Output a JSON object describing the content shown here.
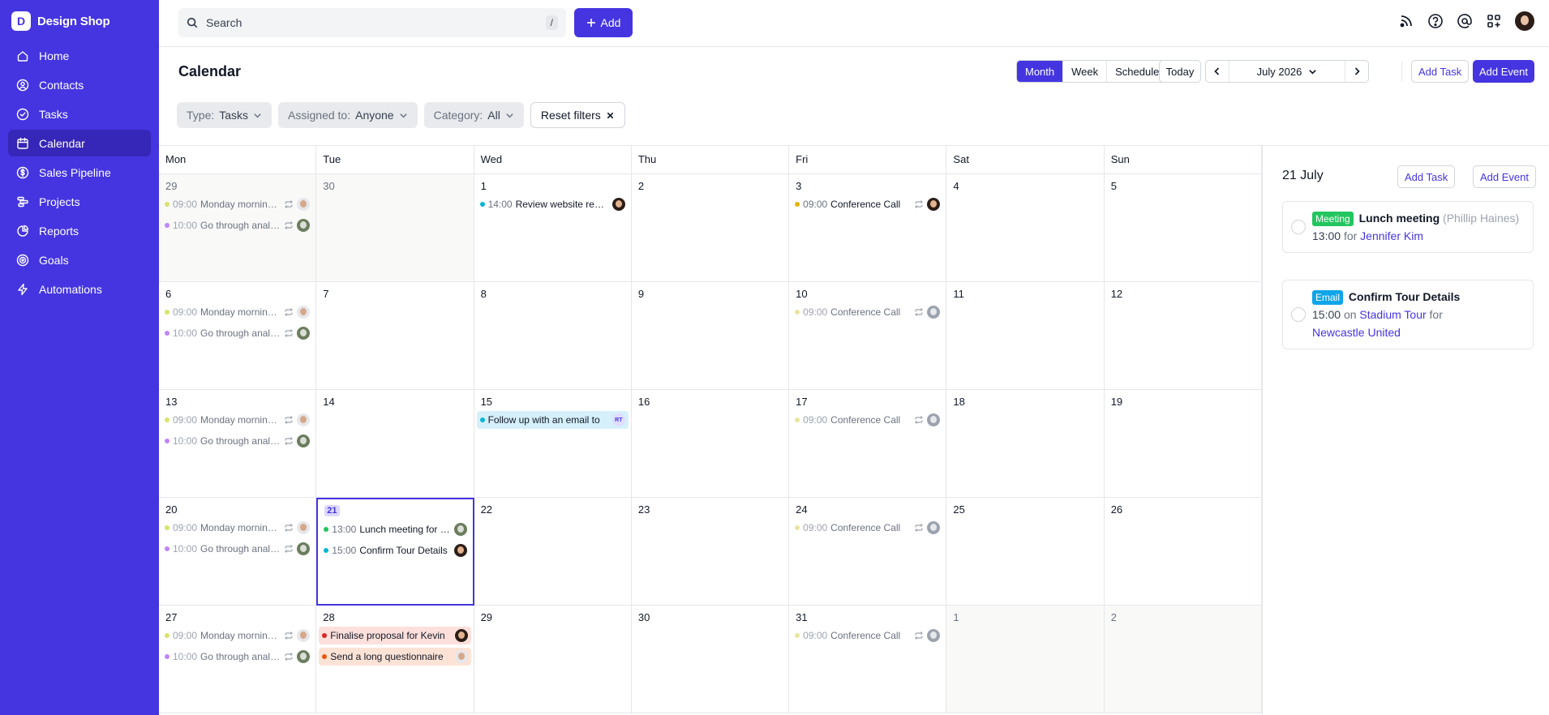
{
  "brand": {
    "logo_letter": "D",
    "name": "Design Shop"
  },
  "sidebar": {
    "items": [
      {
        "label": "Home",
        "icon": "home-icon"
      },
      {
        "label": "Contacts",
        "icon": "contacts-icon"
      },
      {
        "label": "Tasks",
        "icon": "tasks-icon"
      },
      {
        "label": "Calendar",
        "icon": "calendar-icon",
        "active": true
      },
      {
        "label": "Sales Pipeline",
        "icon": "dollar-icon"
      },
      {
        "label": "Projects",
        "icon": "projects-icon"
      },
      {
        "label": "Reports",
        "icon": "reports-icon"
      },
      {
        "label": "Goals",
        "icon": "goals-icon"
      },
      {
        "label": "Automations",
        "icon": "lightning-icon"
      }
    ]
  },
  "topbar": {
    "search_placeholder": "Search",
    "search_shortcut": "/",
    "add_label": "Add"
  },
  "header": {
    "title": "Calendar",
    "views": [
      "Month",
      "Week",
      "Schedule"
    ],
    "active_view": "Month",
    "today_label": "Today",
    "month_label": "July 2026",
    "add_task_label": "Add Task",
    "add_event_label": "Add Event"
  },
  "filters": {
    "type_label": "Type:",
    "type_value": "Tasks",
    "assigned_label": "Assigned to:",
    "assigned_value": "Anyone",
    "category_label": "Category:",
    "category_value": "All",
    "reset_label": "Reset filters"
  },
  "calendar": {
    "weekdays": [
      "Mon",
      "Tue",
      "Wed",
      "Thu",
      "Fri",
      "Sat",
      "Sun"
    ],
    "days": [
      {
        "num": "29",
        "out": true,
        "events": [
          {
            "time": "09:00",
            "title": "Monday morning meeting",
            "dot": "#d9e26b",
            "muted": true,
            "repeat": true,
            "avatar": "light"
          },
          {
            "time": "10:00",
            "title": "Go through analytics",
            "dot": "#c084fc",
            "muted": true,
            "repeat": true,
            "avatar": "olive"
          }
        ]
      },
      {
        "num": "30",
        "out": true,
        "events": []
      },
      {
        "num": "1",
        "events": [
          {
            "time": "14:00",
            "title": "Review website redesign",
            "dot": "#06b6d4",
            "avatar": "dark"
          }
        ]
      },
      {
        "num": "2",
        "events": []
      },
      {
        "num": "3",
        "events": [
          {
            "time": "09:00",
            "title": "Conference Call",
            "dot": "#eab308",
            "repeat": true,
            "avatar": "dark"
          }
        ]
      },
      {
        "num": "4",
        "events": []
      },
      {
        "num": "5",
        "events": []
      },
      {
        "num": "6",
        "events": [
          {
            "time": "09:00",
            "title": "Monday morning meeting",
            "dot": "#d9e26b",
            "muted": true,
            "repeat": true,
            "avatar": "light"
          },
          {
            "time": "10:00",
            "title": "Go through analytics",
            "dot": "#c084fc",
            "muted": true,
            "repeat": true,
            "avatar": "olive"
          }
        ]
      },
      {
        "num": "7",
        "events": []
      },
      {
        "num": "8",
        "events": []
      },
      {
        "num": "9",
        "events": []
      },
      {
        "num": "10",
        "events": [
          {
            "time": "09:00",
            "title": "Conference Call",
            "dot": "#e5e7a0",
            "muted": true,
            "repeat": true,
            "avatar": "grey"
          }
        ]
      },
      {
        "num": "11",
        "events": []
      },
      {
        "num": "12",
        "events": []
      },
      {
        "num": "13",
        "events": [
          {
            "time": "09:00",
            "title": "Monday morning meeting",
            "dot": "#d9e26b",
            "muted": true,
            "repeat": true,
            "avatar": "light"
          },
          {
            "time": "10:00",
            "title": "Go through analytics",
            "dot": "#c084fc",
            "muted": true,
            "repeat": true,
            "avatar": "olive"
          }
        ]
      },
      {
        "num": "14",
        "events": []
      },
      {
        "num": "15",
        "events": [
          {
            "time": "",
            "title": "Follow up with an email to",
            "dot": "#06b6d4",
            "bg": "bg-blue",
            "avatar": "initials",
            "initials": "RT"
          }
        ]
      },
      {
        "num": "16",
        "events": []
      },
      {
        "num": "17",
        "events": [
          {
            "time": "09:00",
            "title": "Conference Call",
            "dot": "#e5e7a0",
            "muted": true,
            "repeat": true,
            "avatar": "grey"
          }
        ]
      },
      {
        "num": "18",
        "events": []
      },
      {
        "num": "19",
        "events": []
      },
      {
        "num": "20",
        "events": [
          {
            "time": "09:00",
            "title": "Monday morning meeting",
            "dot": "#d9e26b",
            "muted": true,
            "repeat": true,
            "avatar": "light"
          },
          {
            "time": "10:00",
            "title": "Go through analytics",
            "dot": "#c084fc",
            "muted": true,
            "repeat": true,
            "avatar": "olive"
          }
        ]
      },
      {
        "num": "21",
        "today": true,
        "events": [
          {
            "time": "13:00",
            "title": "Lunch meeting for Phillip Haines",
            "dot": "#22c55e",
            "avatar": "olive"
          },
          {
            "time": "15:00",
            "title": "Confirm Tour Details",
            "dot": "#06b6d4",
            "avatar": "dark"
          }
        ]
      },
      {
        "num": "22",
        "events": []
      },
      {
        "num": "23",
        "events": []
      },
      {
        "num": "24",
        "events": [
          {
            "time": "09:00",
            "title": "Conference Call",
            "dot": "#e5e7a0",
            "muted": true,
            "repeat": true,
            "avatar": "grey"
          }
        ]
      },
      {
        "num": "25",
        "events": []
      },
      {
        "num": "26",
        "events": []
      },
      {
        "num": "27",
        "events": [
          {
            "time": "09:00",
            "title": "Monday morning meeting",
            "dot": "#d9e26b",
            "muted": true,
            "repeat": true,
            "avatar": "light"
          },
          {
            "time": "10:00",
            "title": "Go through analytics",
            "dot": "#c084fc",
            "muted": true,
            "repeat": true,
            "avatar": "olive"
          }
        ]
      },
      {
        "num": "28",
        "events": [
          {
            "time": "",
            "title": "Finalise proposal for Kevin",
            "dot": "#dc2626",
            "bg": "bg-red",
            "avatar": "dark"
          },
          {
            "time": "",
            "title": "Send a long questionnaire",
            "dot": "#ea580c",
            "bg": "bg-orange",
            "avatar": "light"
          }
        ]
      },
      {
        "num": "29",
        "events": []
      },
      {
        "num": "30",
        "events": []
      },
      {
        "num": "31",
        "events": [
          {
            "time": "09:00",
            "title": "Conference Call",
            "dot": "#e5e7a0",
            "muted": true,
            "repeat": true,
            "avatar": "grey"
          }
        ]
      },
      {
        "num": "1",
        "out": true,
        "events": []
      },
      {
        "num": "2",
        "out": true,
        "events": []
      }
    ]
  },
  "panel": {
    "date": "21 July",
    "add_task_label": "Add Task",
    "add_event_label": "Add Event",
    "cards": [
      {
        "tag": "Meeting",
        "title": "Lunch meeting",
        "sub": "(Phillip Haines)",
        "time": "13:00",
        "joiner": "for",
        "link": "Jennifer Kim"
      },
      {
        "tag": "Email",
        "title": "Confirm Tour Details",
        "time": "15:00",
        "joiner": "on",
        "link": "Stadium Tour",
        "joiner2": "for",
        "link2": "Newcastle United"
      }
    ]
  },
  "colors": {
    "accent": "#4535e0",
    "sidebar": "#4535e0",
    "today_border": "#4535e0"
  }
}
